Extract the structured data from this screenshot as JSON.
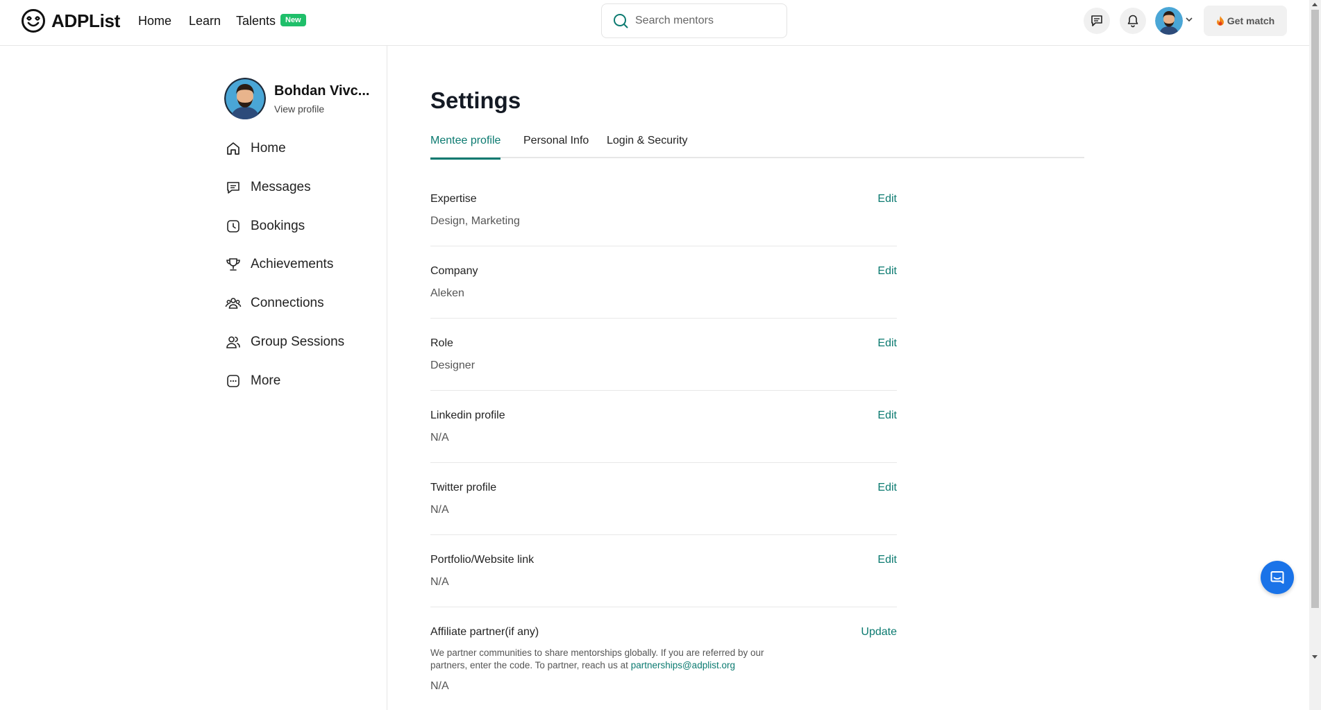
{
  "brand": {
    "name": "ADPList"
  },
  "nav": {
    "home": "Home",
    "learn": "Learn",
    "talents": "Talents",
    "new_badge": "New"
  },
  "search": {
    "placeholder": "Search mentors"
  },
  "header": {
    "get_match": "Get match"
  },
  "profile": {
    "name": "Bohdan Vivc...",
    "view_profile": "View profile"
  },
  "sidebar": {
    "items": [
      {
        "label": "Home",
        "icon": "home-icon"
      },
      {
        "label": "Messages",
        "icon": "messages-icon"
      },
      {
        "label": "Bookings",
        "icon": "clock-icon"
      },
      {
        "label": "Achievements",
        "icon": "trophy-icon"
      },
      {
        "label": "Connections",
        "icon": "connections-icon"
      },
      {
        "label": "Group Sessions",
        "icon": "group-icon"
      },
      {
        "label": "More",
        "icon": "more-icon"
      }
    ]
  },
  "main": {
    "title": "Settings",
    "tabs": [
      {
        "label": "Mentee profile",
        "active": true
      },
      {
        "label": "Personal Info",
        "active": false
      },
      {
        "label": "Login & Security",
        "active": false
      }
    ],
    "fields": [
      {
        "label": "Expertise",
        "value": "Design, Marketing",
        "action": "Edit"
      },
      {
        "label": "Company",
        "value": "Aleken",
        "action": "Edit"
      },
      {
        "label": "Role",
        "value": "Designer",
        "action": "Edit"
      },
      {
        "label": "Linkedin profile",
        "value": "N/A",
        "action": "Edit"
      },
      {
        "label": "Twitter profile",
        "value": "N/A",
        "action": "Edit"
      },
      {
        "label": "Portfolio/Website link",
        "value": "N/A",
        "action": "Edit"
      }
    ],
    "affiliate": {
      "label": "Affiliate partner(if any)",
      "action": "Update",
      "description": "We partner communities to share mentorships globally. If you are referred by our partners, enter the code. To partner, reach us at ",
      "email": "partnerships@adplist.org",
      "value": "N/A"
    }
  },
  "colors": {
    "accent": "#0b7a70",
    "new_badge": "#1fbf6a",
    "chat_fab": "#1a73e8"
  }
}
